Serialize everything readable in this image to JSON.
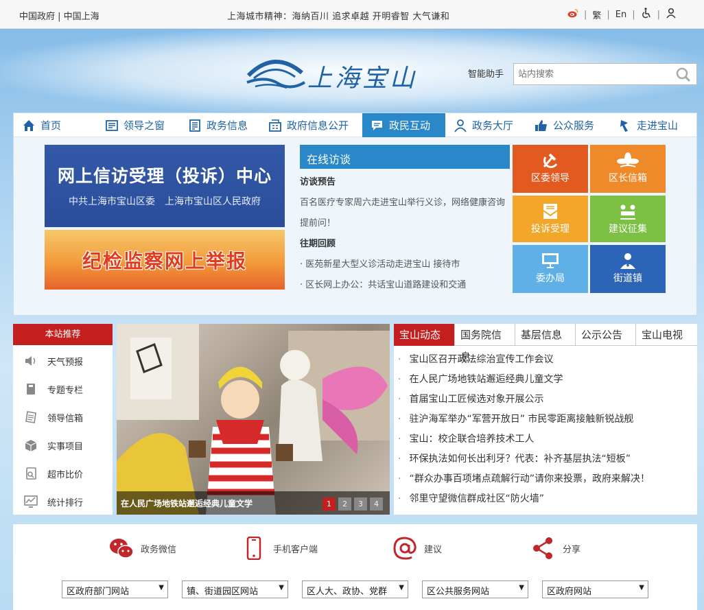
{
  "topbar": {
    "gov_links": "中国政府 | 中国上海",
    "slogan": "上海城市精神：海纳百川 追求卓越 开明睿智 大气谦和",
    "traditional": "繁",
    "english": "En"
  },
  "header": {
    "logo_text": "上海宝山",
    "assistant_label": "智能助手",
    "search_placeholder": "站内搜索"
  },
  "nav": {
    "items": [
      {
        "label": "首页",
        "icon": "home-icon"
      },
      {
        "label": "领导之窗",
        "icon": "leader-icon"
      },
      {
        "label": "政务信息",
        "icon": "info-icon"
      },
      {
        "label": "政府信息公开",
        "icon": "building-icon"
      },
      {
        "label": "政民互动",
        "icon": "chat-icon"
      },
      {
        "label": "政务大厅",
        "icon": "person-icon"
      },
      {
        "label": "公众服务",
        "icon": "thumb-icon"
      },
      {
        "label": "走进宝山",
        "icon": "tour-icon"
      }
    ],
    "active_index": 4
  },
  "banners": {
    "petition_title": "网上信访受理（投诉）中心",
    "petition_sub": "中共上海市宝山区委　上海市宝山区人民政府",
    "report_title": "纪检监察网上举报"
  },
  "online_talk": {
    "title": "在线访谈",
    "preview_label": "访谈预告",
    "preview_text": "百名医疗专家周六走进宝山举行义诊，网络健康咨询提前问！",
    "review_label": "往期回顾",
    "review_items": [
      "· 医苑新星大型义诊活动走进宝山 接待市",
      "· 区长网上办公：共话宝山道路建设和交通"
    ]
  },
  "tiles": [
    {
      "label": "区委领导",
      "color": "#e25a1f"
    },
    {
      "label": "区长信箱",
      "color": "#ef8a2b"
    },
    {
      "label": "投诉受理",
      "color": "#f2a72a"
    },
    {
      "label": "建议征集",
      "color": "#7cc143"
    },
    {
      "label": "委办局",
      "color": "#5fb0e6"
    },
    {
      "label": "街道镇",
      "color": "#2c64b8"
    }
  ],
  "recommend": {
    "title": "本站推荐",
    "items": [
      "天气预报",
      "专题专栏",
      "领导信箱",
      "实事项目",
      "超市比价",
      "统计排行"
    ]
  },
  "slideshow": {
    "caption": "在人民广场地铁站邂逅经典儿童文学",
    "pages": [
      "1",
      "2",
      "3",
      "4"
    ],
    "current": 1
  },
  "news": {
    "tabs": [
      "宝山动态",
      "国务院信息",
      "基层信息",
      "公示公告",
      "宝山电视"
    ],
    "active_tab": 0,
    "items": [
      "宝山区召开政法综治宣传工作会议",
      "在人民广场地铁站邂逅经典儿童文学",
      "首届宝山工匠候选对象开展公示",
      "驻沪海军举办“军营开放日” 市民零距离接触新锐战舰",
      "宝山：校企联合培养技术工人",
      "环保执法如何长出利牙？代表：补齐基层执法“短板”",
      "“群众办事百项堵点疏解行动”请你来投票，政府来解决！",
      "邻里守望微信群成社区“防火墙”"
    ]
  },
  "services": [
    {
      "label": "政务微信",
      "icon": "wechat-icon"
    },
    {
      "label": "手机客户端",
      "icon": "phone-icon"
    },
    {
      "label": "建议",
      "icon": "at-icon"
    },
    {
      "label": "分享",
      "icon": "share-icon"
    }
  ],
  "site_selects": [
    "区政府部门网站",
    "镇、街道园区网站",
    "区人大、政协、党群",
    "区公共服务网站",
    "区政府网站"
  ]
}
